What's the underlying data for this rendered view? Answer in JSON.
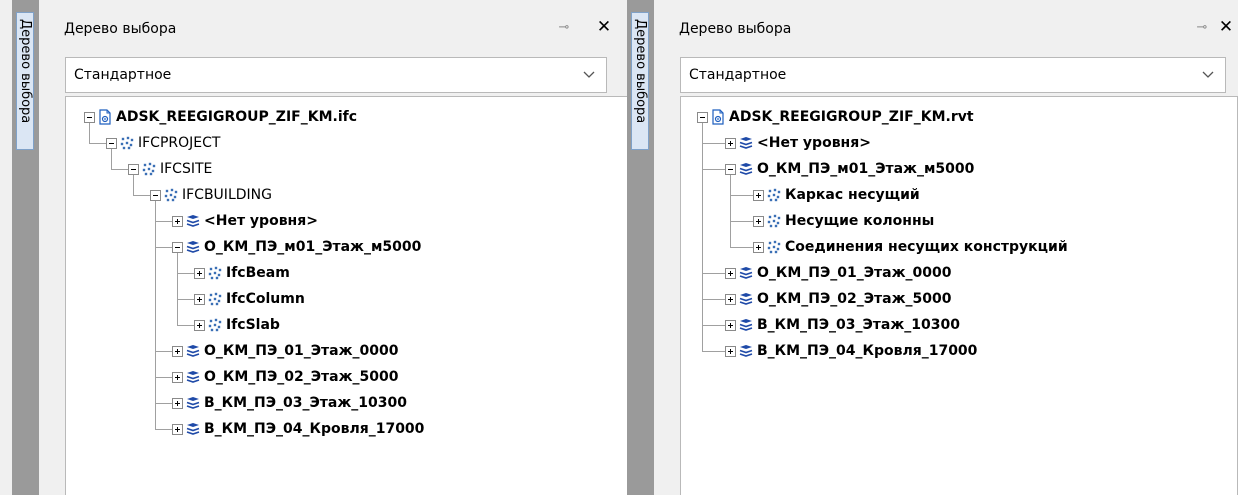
{
  "left_panel": {
    "side_tab_label": "Дерево выбора",
    "title": "Дерево выбора",
    "selector_value": "Стандартное",
    "tree": [
      {
        "label": "ADSK_REEGIGROUP_ZIF_KM.ifc",
        "level": 0,
        "bold": true,
        "icon": "document-icon",
        "expander": "minus"
      },
      {
        "label": "IFCPROJECT",
        "level": 1,
        "bold": false,
        "icon": "dots-icon",
        "expander": "minus"
      },
      {
        "label": "IFCSITE",
        "level": 2,
        "bold": false,
        "icon": "dots-icon",
        "expander": "minus"
      },
      {
        "label": "IFCBUILDING",
        "level": 3,
        "bold": false,
        "icon": "dots-icon",
        "expander": "minus"
      },
      {
        "label": "<Нет уровня>",
        "level": 4,
        "bold": true,
        "icon": "layers-icon",
        "expander": "plus"
      },
      {
        "label": "О_КМ_ПЭ_м01_Этаж_м5000",
        "level": 4,
        "bold": true,
        "icon": "layers-icon",
        "expander": "minus"
      },
      {
        "label": "IfcBeam",
        "level": 5,
        "bold": true,
        "icon": "dots-icon",
        "expander": "plus"
      },
      {
        "label": "IfcColumn",
        "level": 5,
        "bold": true,
        "icon": "dots-icon",
        "expander": "plus"
      },
      {
        "label": "IfcSlab",
        "level": 5,
        "bold": true,
        "icon": "dots-icon",
        "expander": "plus"
      },
      {
        "label": "О_КМ_ПЭ_01_Этаж_0000",
        "level": 4,
        "bold": true,
        "icon": "layers-icon",
        "expander": "plus"
      },
      {
        "label": "О_КМ_ПЭ_02_Этаж_5000",
        "level": 4,
        "bold": true,
        "icon": "layers-icon",
        "expander": "plus"
      },
      {
        "label": "В_КМ_ПЭ_03_Этаж_10300",
        "level": 4,
        "bold": true,
        "icon": "layers-icon",
        "expander": "plus"
      },
      {
        "label": "В_КМ_ПЭ_04_Кровля_17000",
        "level": 4,
        "bold": true,
        "icon": "layers-icon",
        "expander": "plus"
      }
    ]
  },
  "right_panel": {
    "side_tab_label": "Дерево выбора",
    "title": "Дерево выбора",
    "selector_value": "Стандартное",
    "tree": [
      {
        "label": "ADSK_REEGIGROUP_ZIF_KM.rvt",
        "level": 0,
        "bold": true,
        "icon": "document-icon",
        "expander": "minus"
      },
      {
        "label": "<Нет уровня>",
        "level": 1,
        "bold": true,
        "icon": "layers-icon",
        "expander": "plus"
      },
      {
        "label": "О_КМ_ПЭ_м01_Этаж_м5000",
        "level": 1,
        "bold": true,
        "icon": "layers-icon",
        "expander": "minus"
      },
      {
        "label": "Каркас несущий",
        "level": 2,
        "bold": true,
        "icon": "dots-icon",
        "expander": "plus"
      },
      {
        "label": "Несущие колонны",
        "level": 2,
        "bold": true,
        "icon": "dots-icon",
        "expander": "plus"
      },
      {
        "label": "Соединения несущих конструкций",
        "level": 2,
        "bold": true,
        "icon": "dots-icon",
        "expander": "plus"
      },
      {
        "label": "О_КМ_ПЭ_01_Этаж_0000",
        "level": 1,
        "bold": true,
        "icon": "layers-icon",
        "expander": "plus"
      },
      {
        "label": "О_КМ_ПЭ_02_Этаж_5000",
        "level": 1,
        "bold": true,
        "icon": "layers-icon",
        "expander": "plus"
      },
      {
        "label": "В_КМ_ПЭ_03_Этаж_10300",
        "level": 1,
        "bold": true,
        "icon": "layers-icon",
        "expander": "plus"
      },
      {
        "label": "В_КМ_ПЭ_04_Кровля_17000",
        "level": 1,
        "bold": true,
        "icon": "layers-icon",
        "expander": "plus"
      }
    ]
  },
  "colors": {
    "side_tab": "#9a9a9a",
    "tab_highlight": "#dbe6f4",
    "doc_icon": "#1f5fbf",
    "dots_icon": "#3a6fb5",
    "layers_icon": "#1f4aa8"
  }
}
